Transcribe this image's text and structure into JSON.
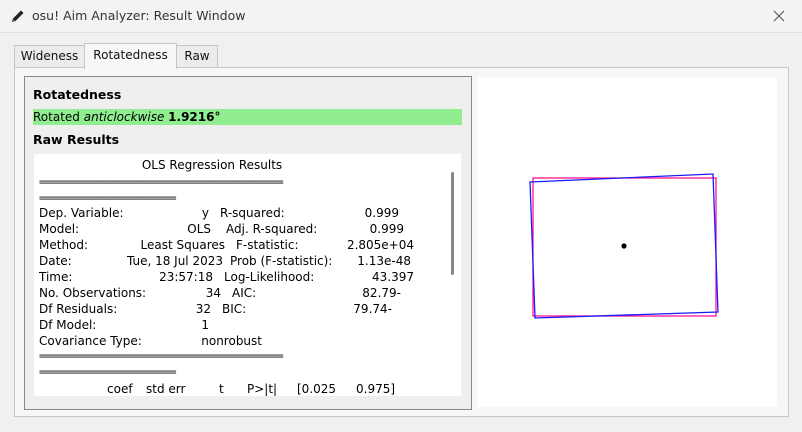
{
  "window": {
    "title": "osu! Aim Analyzer: Result Window",
    "app_icon": "pencil-icon",
    "close_icon": "close-icon"
  },
  "tabs": [
    {
      "label": "Wideness",
      "active": false
    },
    {
      "label": "Rotatedness",
      "active": true
    },
    {
      "label": "Raw",
      "active": false
    }
  ],
  "rotatedness": {
    "title": "Rotatedness",
    "prefix": "Rotated",
    "direction": "anticlockwise",
    "angle": "1.9216°",
    "bar_color": "#90ee90"
  },
  "raw_results": {
    "title": "Raw Results",
    "header": "OLS Regression Results",
    "separator1": "==================================================",
    "separator2": "============================",
    "rows": [
      {
        "l": "Dep. Variable:",
        "lv": "y",
        "r": "R-squared:",
        "rv": "0.999"
      },
      {
        "l": "Model:",
        "lv": "OLS",
        "r": "Adj. R-squared:",
        "rv": "0.999"
      },
      {
        "l": "Method:",
        "lv": "Least Squares",
        "r": "F-statistic:",
        "rv": "2.805e+04"
      },
      {
        "l": "Date:",
        "lv": "Tue, 18 Jul 2023",
        "r": "Prob (F-statistic):",
        "rv": "1.13e-48"
      },
      {
        "l": "Time:",
        "lv": "23:57:18",
        "r": "Log-Likelihood:",
        "rv": "43.397"
      },
      {
        "l": "No. Observations:",
        "lv": "34",
        "r": "AIC:",
        "rv": "-82.79"
      },
      {
        "l": "Df Residuals:",
        "lv": "32",
        "r": "BIC:",
        "rv": "-79.74"
      },
      {
        "l": "Df Model:",
        "lv": "1",
        "r": "",
        "rv": ""
      },
      {
        "l": "Covariance Type:",
        "lv": "nonrobust",
        "r": "",
        "rv": ""
      }
    ],
    "separator3": "==================================================",
    "separator4": "============================",
    "coef_header": [
      "coef",
      "std err",
      "t",
      "P>|t|",
      "[0.025",
      "0.975]"
    ]
  },
  "diagram": {
    "reference_color": "#ff1493",
    "rotated_color": "#1a1aff",
    "center_color": "#000000"
  }
}
